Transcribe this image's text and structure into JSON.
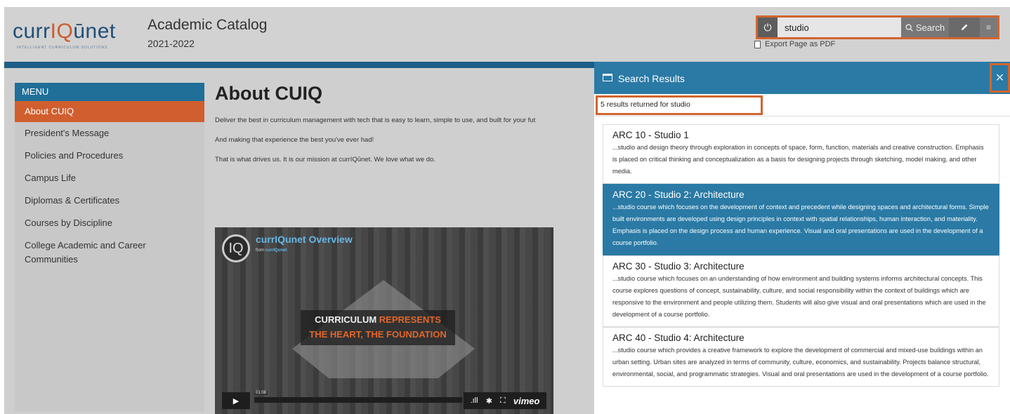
{
  "header": {
    "logo_text_a": "curr",
    "logo_text_q": "IQ",
    "logo_text_b": "ūnet",
    "logo_tagline": "INTELLIGENT CURRICULUM SOLUTIONS",
    "catalog_title": "Academic Catalog",
    "catalog_year": "2021-2022",
    "search_value": "studio",
    "search_label": "Search",
    "export_label": "Export Page as PDF"
  },
  "sidebar": {
    "menu_label": "MENU",
    "items": [
      {
        "label": "About CUIQ",
        "active": true
      },
      {
        "label": "President's Message"
      },
      {
        "label": "Policies and Procedures"
      },
      {
        "label": "Campus Life"
      },
      {
        "label": "Diplomas & Certificates"
      },
      {
        "label": "Courses by Discipline"
      },
      {
        "label": "College Academic and Career Communities"
      }
    ]
  },
  "content": {
    "title": "About CUIQ",
    "paragraphs": [
      "Deliver the best in curriculum management with tech that is easy to learn, simple to use, and built for your fut",
      "And making that experience the best you've ever had!",
      "That is what drives us. It is our mission at currIQūnet.  We love what we do."
    ]
  },
  "video": {
    "title": "currIQunet Overview",
    "from_prefix": "from",
    "from_source": "currIQunet",
    "banner_line1_a": "CURRICULUM",
    "banner_line1_b": "REPRESENTS",
    "banner_line2": "THE HEART, THE FOUNDATION",
    "timestamp": "01:08",
    "brand": "vimeo"
  },
  "results": {
    "title": "Search Results",
    "count_text": "5 results returned for studio",
    "items": [
      {
        "title": "ARC 10 - Studio 1",
        "desc": "...studio and design theory through exploration in concepts of space, form, function, materials and creative construction. Emphasis is placed on critical thinking and conceptualization as a basis for designing projects through sketching, model making, and other media.",
        "active": false
      },
      {
        "title": "ARC 20 - Studio 2: Architecture",
        "desc": "...studio course which focuses on the development of context and precedent while designing spaces and architectural forms. Simple built environments are developed using design principles in context with spatial relationships, human interaction, and materiality. Emphasis is placed on the design process and human experience. Visual and oral presentations are used in the development of a course portfolio.",
        "active": true
      },
      {
        "title": "ARC 30 - Studio 3: Architecture",
        "desc": "...studio course which focuses on an understanding of how environment and building systems informs architectural concepts. This course explores questions of concept, sustainability, culture, and social responsibility within the context of buildings which are responsive to the environment and people utilizing them. Students will also give visual and oral presentations which are used in the development of a course portfolio.",
        "active": false
      },
      {
        "title": "ARC 40 - Studio 4: Architecture",
        "desc": "...studio course which provides a creative framework to explore the development of commercial and mixed-use buildings within an urban setting. Urban sites are analyzed in terms of community, culture, economics, and sustainability. Projects balance structural, environmental, social, and programmatic strategies. Visual and oral presentations are used in the development of a course portfolio.",
        "active": false
      }
    ]
  },
  "colors": {
    "brand_blue": "#1f6f98",
    "accent_orange": "#d15e2e",
    "highlight_orange": "#d1652e"
  }
}
